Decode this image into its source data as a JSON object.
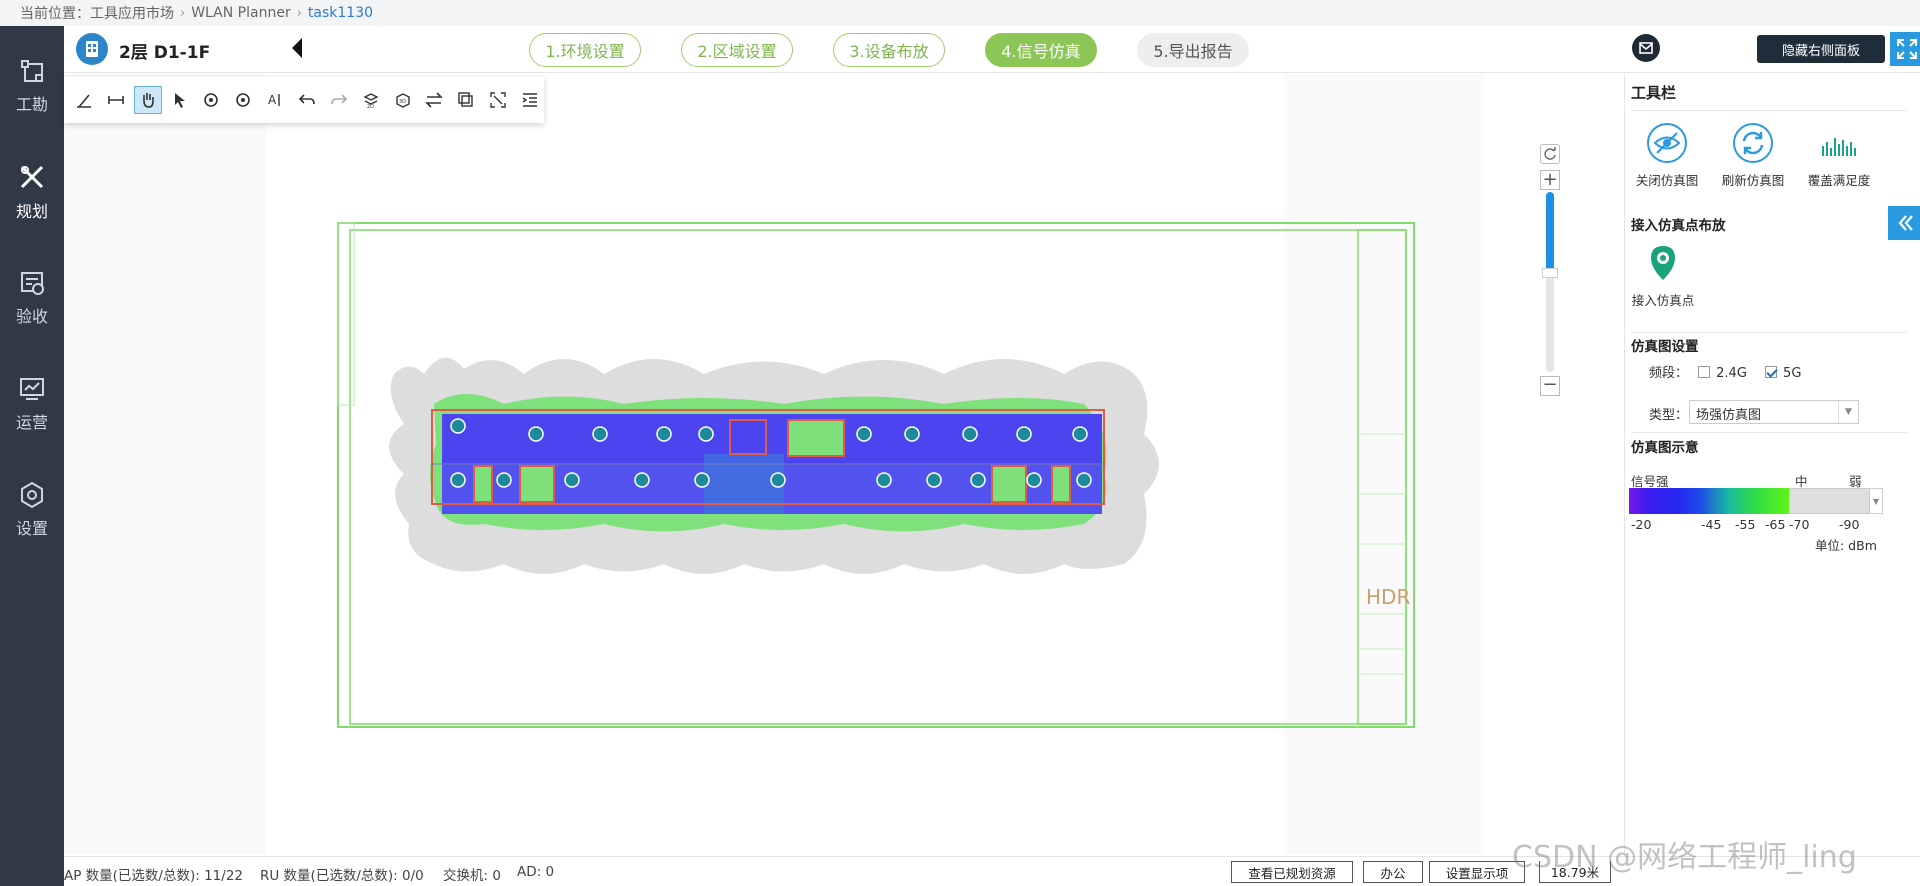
{
  "breadcrumb": {
    "prefix": "当前位置：",
    "items": [
      "工具应用市场",
      "WLAN Planner",
      "task1130"
    ]
  },
  "leftnav": [
    {
      "label": "工勘",
      "icon": "survey-icon"
    },
    {
      "label": "规划",
      "icon": "planning-icon",
      "active": true
    },
    {
      "label": "验收",
      "icon": "acceptance-icon"
    },
    {
      "label": "运营",
      "icon": "operation-icon"
    },
    {
      "label": "设置",
      "icon": "settings-icon"
    }
  ],
  "header": {
    "floor_title": "2层 D1-1F",
    "steps": [
      {
        "label": "1.环境设置",
        "state": "done"
      },
      {
        "label": "2.区域设置",
        "state": "done"
      },
      {
        "label": "3.设备布放",
        "state": "done"
      },
      {
        "label": "4.信号仿真",
        "state": "active"
      },
      {
        "label": "5.导出报告",
        "state": "todo"
      }
    ],
    "hide_panel_label": "隐藏右侧面板"
  },
  "toolbar_tools": [
    "measure-icon",
    "distance-icon",
    "pan-hand-icon",
    "select-arrow-icon",
    "rotate-ccw-icon",
    "rotate-cw-icon",
    "text-tool-icon",
    "undo-icon",
    "redo-icon",
    "layer-2d-icon",
    "layer-3d-icon",
    "swap-icon",
    "copy-icon",
    "fit-screen-icon",
    "list-indent-icon"
  ],
  "rightpanel": {
    "toolbar_title": "工具栏",
    "buttons": [
      {
        "label": "关闭仿真图",
        "icon": "eye-off-icon"
      },
      {
        "label": "刷新仿真图",
        "icon": "refresh-icon"
      },
      {
        "label": "覆盖满足度",
        "icon": "coverage-chart-icon"
      }
    ],
    "access_section": "接入仿真点布放",
    "access_button": "接入仿真点",
    "sim_settings": "仿真图设置",
    "band_label": "频段：",
    "band_24": "2.4G",
    "band_5": "5G",
    "band_24_checked": false,
    "band_5_checked": true,
    "type_label": "类型：",
    "type_value": "场强仿真图",
    "legend_title": "仿真图示意",
    "legend_strong": "信号强",
    "legend_mid": "中",
    "legend_weak": "弱",
    "legend_ticks": [
      "-20",
      "-45",
      "-55",
      "-65",
      "-70",
      "-90"
    ],
    "unit": "单位: dBm",
    "legend_colors": [
      "#7a16e8",
      "#2626f0",
      "#19b8a2",
      "#5ef31a",
      "#dedede"
    ]
  },
  "zoom": {
    "level_fraction": 0.45
  },
  "status": {
    "ap": "AP 数量(已选数/总数): 11/22",
    "ru": "RU 数量(已选数/总数): 0/0",
    "switch": "交换机: 0",
    "ad": "AD: 0",
    "btn_view": "查看已规划资源",
    "btn_office": "办公",
    "btn_display": "设置显示项",
    "scale": "18.79米"
  },
  "watermark": "CSDN @网络工程师_ling"
}
